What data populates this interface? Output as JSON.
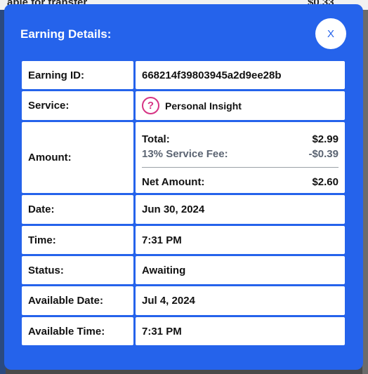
{
  "background": {
    "strip_left": "able for transfer",
    "strip_right": "$0.33"
  },
  "modal": {
    "title": "Earning Details:",
    "close_label": "X",
    "accent_color": "#2563eb"
  },
  "rows": {
    "earning_id": {
      "label": "Earning ID:",
      "value": "668214f39803945a2d9ee28b"
    },
    "service": {
      "label": "Service:",
      "icon": "question-circle-icon",
      "icon_glyph": "?",
      "value": "Personal Insight"
    },
    "amount": {
      "label": "Amount:",
      "total_label": "Total:",
      "total_value": "$2.99",
      "fee_label": "13% Service Fee:",
      "fee_value": "-$0.39",
      "net_label": "Net Amount:",
      "net_value": "$2.60"
    },
    "date": {
      "label": "Date:",
      "value": "Jun 30, 2024"
    },
    "time": {
      "label": "Time:",
      "value": "7:31 PM"
    },
    "status": {
      "label": "Status:",
      "value": "Awaiting",
      "color": "#ca8a04"
    },
    "available_date": {
      "label": "Available Date:",
      "value": "Jul 4, 2024"
    },
    "available_time": {
      "label": "Available Time:",
      "value": "7:31 PM"
    }
  }
}
